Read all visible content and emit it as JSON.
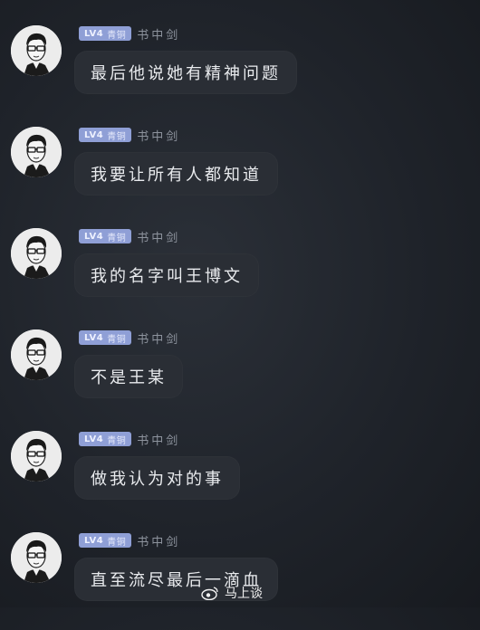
{
  "messages": [
    {
      "level": "LV4",
      "rank": "青铜",
      "sender": "书中剑",
      "text": "最后他说她有精神问题"
    },
    {
      "level": "LV4",
      "rank": "青铜",
      "sender": "书中剑",
      "text": "我要让所有人都知道"
    },
    {
      "level": "LV4",
      "rank": "青铜",
      "sender": "书中剑",
      "text": "我的名字叫王博文"
    },
    {
      "level": "LV4",
      "rank": "青铜",
      "sender": "书中剑",
      "text": "不是王某"
    },
    {
      "level": "LV4",
      "rank": "青铜",
      "sender": "书中剑",
      "text": "做我认为对的事"
    },
    {
      "level": "LV4",
      "rank": "青铜",
      "sender": "书中剑",
      "text": "直至流尽最后一滴血"
    }
  ],
  "watermark": {
    "text": "马上谈",
    "icon": "weibo-icon"
  },
  "colors": {
    "background": "#1f232a",
    "bubble": "#2a2e35",
    "badge": "#8f9fd6",
    "text": "#e9ebee"
  }
}
